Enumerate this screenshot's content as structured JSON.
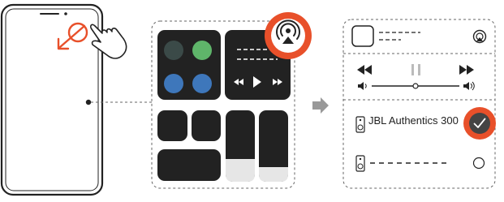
{
  "output_panel": {
    "devices": [
      {
        "name": "JBL Authentics 300",
        "selected": true
      },
      {
        "name": "",
        "selected": false
      }
    ]
  },
  "icons": [
    "swipe-down-gesture-icon",
    "airplay-icon",
    "rewind-icon",
    "pause-icon",
    "fast-forward-icon",
    "volume-low-icon",
    "volume-high-icon",
    "speaker-icon",
    "checkmark-icon",
    "radio-empty-icon",
    "right-arrow-icon"
  ],
  "colors": {
    "accent_orange": "#e8502a",
    "tile_dark": "#222222",
    "dot_dark": "#3b4a48",
    "dot_green": "#5fb56a",
    "dot_blue": "#3e77bb",
    "slider_fill": "#e6e6e6"
  }
}
